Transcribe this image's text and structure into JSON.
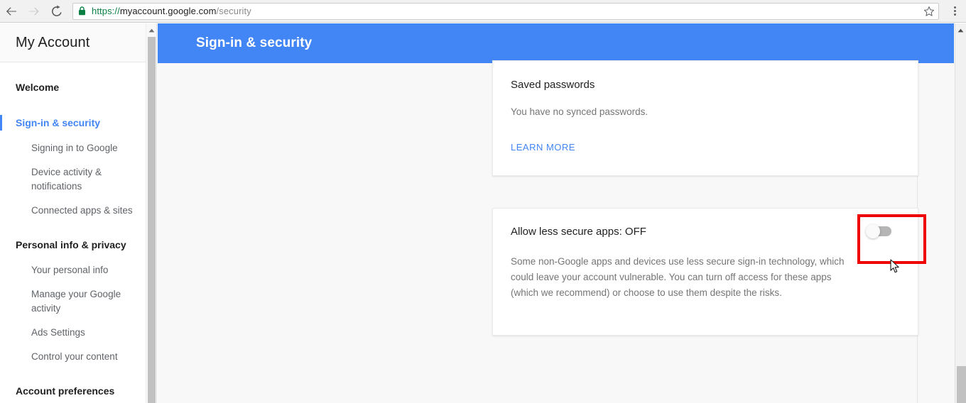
{
  "browser": {
    "back_label": "Back",
    "forward_label": "Forward",
    "reload_label": "Reload",
    "url_scheme": "https://",
    "url_host": "myaccount.google.com",
    "url_path": "/security",
    "url_full": "https://myaccount.google.com/security",
    "bookmark_label": "Bookmark this page",
    "menu_label": "Customize and control Google Chrome",
    "secure_label": "Secure"
  },
  "sidebar": {
    "title": "My Account",
    "nav": [
      {
        "label": "Welcome",
        "type": "group",
        "active": false
      },
      {
        "label": "Sign-in & security",
        "type": "group",
        "active": true
      },
      {
        "label": "Signing in to Google",
        "type": "sub",
        "active": false
      },
      {
        "label": "Device activity & notifications",
        "type": "sub",
        "active": false
      },
      {
        "label": "Connected apps & sites",
        "type": "sub",
        "active": false
      },
      {
        "label": "Personal info & privacy",
        "type": "group",
        "active": false
      },
      {
        "label": "Your personal info",
        "type": "sub",
        "active": false
      },
      {
        "label": "Manage your Google activity",
        "type": "sub",
        "active": false
      },
      {
        "label": "Ads Settings",
        "type": "sub",
        "active": false
      },
      {
        "label": "Control your content",
        "type": "sub",
        "active": false
      },
      {
        "label": "Account preferences",
        "type": "group",
        "active": false
      }
    ]
  },
  "header": {
    "title": "Sign-in & security",
    "accent_color": "#4285f4"
  },
  "cards": {
    "saved_passwords": {
      "title": "Saved passwords",
      "body": "You have no synced passwords.",
      "link": "LEARN MORE"
    },
    "less_secure_apps": {
      "title": "Allow less secure apps: OFF",
      "body": "Some non-Google apps and devices use less secure sign-in technology, which could leave your account vulnerable. You can turn off access for these apps (which we recommend) or choose to use them despite the risks.",
      "toggle_state": "OFF",
      "toggle_label": "Allow less secure apps toggle"
    }
  },
  "annotation": {
    "color": "#ee0000",
    "target": "less-secure-apps-toggle"
  },
  "scrollbars": {
    "sidebar_label": "Sidebar scrollbar",
    "page_label": "Page scrollbar",
    "arrow_up_icon": "caret-up-icon"
  },
  "cursor": {
    "icon": "arrow-cursor"
  }
}
